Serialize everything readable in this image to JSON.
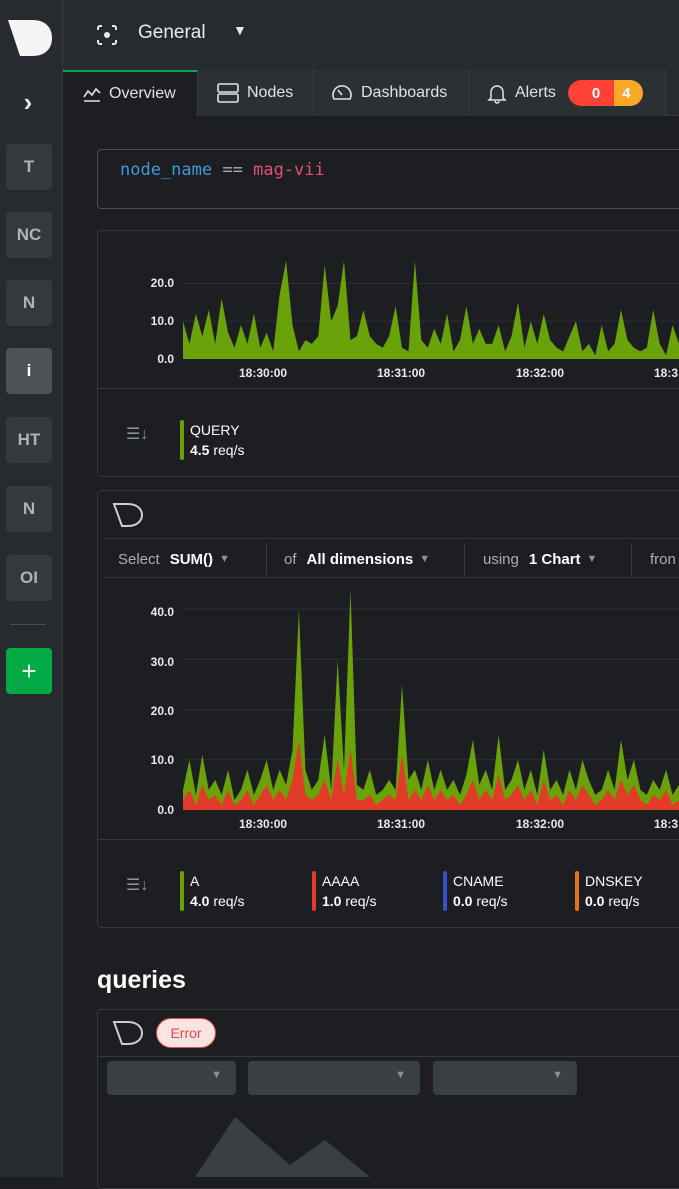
{
  "sidebar": {
    "spaces": [
      "T",
      "NC",
      "N",
      "i",
      "HT",
      "N",
      "OI"
    ],
    "add_label": "+"
  },
  "header": {
    "room_name": "General"
  },
  "tabs": {
    "overview": "Overview",
    "nodes": "Nodes",
    "dashboards": "Dashboards",
    "alerts": "Alerts",
    "alerts_critical": "0",
    "alerts_warning": "4"
  },
  "filter": {
    "field": "node_name",
    "operator": "==",
    "value": "mag-vii"
  },
  "chart_data": [
    {
      "type": "area",
      "title": "",
      "x": [
        "18:30:00",
        "18:31:00",
        "18:32:00",
        "18:3"
      ],
      "y_ticks": [
        "20.0",
        "10.0",
        "0.0"
      ],
      "ylim": [
        0,
        27
      ],
      "series": [
        {
          "name": "QUERY",
          "color": "#6aa20a",
          "values": [
            10,
            4,
            12,
            6,
            13,
            4,
            16,
            7,
            3,
            9,
            4,
            12,
            3,
            7,
            2,
            17,
            26,
            9,
            2,
            5,
            4,
            6,
            25,
            10,
            14,
            26,
            5,
            6,
            13,
            6,
            4,
            3,
            6,
            14,
            3,
            2,
            26,
            5,
            3,
            8,
            4,
            12,
            2,
            5,
            14,
            4,
            8,
            4,
            4,
            9,
            2,
            6,
            15,
            3,
            10,
            4,
            12,
            5,
            3,
            2,
            6,
            10,
            2,
            4,
            1,
            9,
            2,
            4,
            13,
            5,
            3,
            2,
            3,
            13,
            4,
            1,
            9,
            4
          ]
        }
      ],
      "legend": [
        {
          "name": "QUERY",
          "value": "4.5",
          "unit": "req/s",
          "color": "#6aa20a"
        }
      ]
    },
    {
      "type": "area",
      "title": "",
      "x": [
        "18:30:00",
        "18:31:00",
        "18:32:00",
        "18:3"
      ],
      "y_ticks": [
        "40.0",
        "30.0",
        "20.0",
        "10.0",
        "0.0"
      ],
      "ylim": [
        0,
        45
      ],
      "series": [
        {
          "name": "A",
          "color": "#6aa20a",
          "values": [
            4,
            10,
            3,
            11,
            4,
            6,
            3,
            8,
            2,
            4,
            8,
            3,
            6,
            10,
            4,
            8,
            5,
            12,
            40,
            8,
            4,
            6,
            15,
            4,
            30,
            8,
            44,
            5,
            4,
            8,
            3,
            4,
            6,
            4,
            25,
            6,
            8,
            4,
            10,
            4,
            8,
            4,
            6,
            3,
            7,
            14,
            5,
            8,
            4,
            15,
            4,
            6,
            10,
            4,
            8,
            3,
            12,
            4,
            6,
            3,
            8,
            4,
            10,
            6,
            3,
            4,
            8,
            4,
            14,
            6,
            10,
            4,
            3,
            6,
            4,
            8,
            3,
            5
          ]
        },
        {
          "name": "AAAA",
          "color": "#e33b2a",
          "values": [
            2,
            4,
            1,
            5,
            2,
            3,
            1,
            4,
            1,
            2,
            4,
            1,
            3,
            5,
            2,
            4,
            2,
            6,
            14,
            3,
            2,
            3,
            6,
            2,
            10,
            3,
            12,
            2,
            2,
            3,
            1,
            2,
            3,
            2,
            11,
            2,
            4,
            2,
            5,
            2,
            4,
            2,
            3,
            1,
            3,
            6,
            2,
            4,
            2,
            7,
            2,
            3,
            5,
            2,
            4,
            1,
            6,
            2,
            3,
            1,
            4,
            2,
            5,
            3,
            1,
            2,
            4,
            2,
            6,
            3,
            5,
            2,
            1,
            3,
            2,
            4,
            1,
            2
          ]
        },
        {
          "name": "CNAME",
          "color": "#3552c8",
          "values": [
            0,
            0,
            0,
            0,
            0,
            0,
            0,
            0,
            0,
            0,
            0,
            0,
            0,
            0,
            0,
            0,
            0,
            0,
            0,
            0,
            0,
            0,
            0,
            0,
            0,
            0,
            0,
            0,
            0,
            0,
            0,
            0,
            0,
            0,
            0,
            0,
            0,
            0,
            0,
            0,
            0,
            0,
            0,
            0,
            0,
            0,
            0,
            0,
            0,
            0,
            0,
            0,
            0,
            0,
            0,
            0,
            0,
            0,
            0,
            0,
            0,
            0,
            0,
            0,
            0,
            0,
            0,
            0,
            0,
            0,
            0,
            0,
            0,
            0,
            0,
            0,
            0,
            0
          ]
        },
        {
          "name": "DNSKEY",
          "color": "#e0741e",
          "values": [
            0,
            0,
            0,
            0,
            0,
            0,
            0,
            0,
            0,
            0,
            0,
            0,
            0,
            0,
            0,
            0,
            0,
            0,
            0,
            0,
            0,
            0,
            0,
            0,
            0,
            0,
            0,
            0,
            0,
            0,
            0,
            0,
            0,
            0,
            0,
            0,
            0,
            0,
            0,
            0,
            0,
            0,
            0,
            0,
            0,
            0,
            0,
            0,
            0,
            0,
            0,
            0,
            0,
            0,
            0,
            0,
            0,
            0,
            0,
            0,
            0,
            0,
            0,
            0,
            0,
            0,
            0,
            0,
            0,
            0,
            0,
            0,
            0,
            0,
            0,
            0,
            0,
            0
          ]
        }
      ],
      "legend": [
        {
          "name": "A",
          "value": "4.0",
          "unit": "req/s",
          "color": "#6aa20a"
        },
        {
          "name": "AAAA",
          "value": "1.0",
          "unit": "req/s",
          "color": "#e33b2a"
        },
        {
          "name": "CNAME",
          "value": "0.0",
          "unit": "req/s",
          "color": "#3552c8"
        },
        {
          "name": "DNSKEY",
          "value": "0.0",
          "unit": "req/s",
          "color": "#e0741e"
        }
      ]
    }
  ],
  "toolbar": {
    "select_label": "Select",
    "select_value": "SUM()",
    "of_label": "of",
    "of_value": "All dimensions",
    "using_label": "using",
    "using_value": "1 Chart",
    "from_label": "fron"
  },
  "section": {
    "title": "queries",
    "error_badge": "Error"
  }
}
